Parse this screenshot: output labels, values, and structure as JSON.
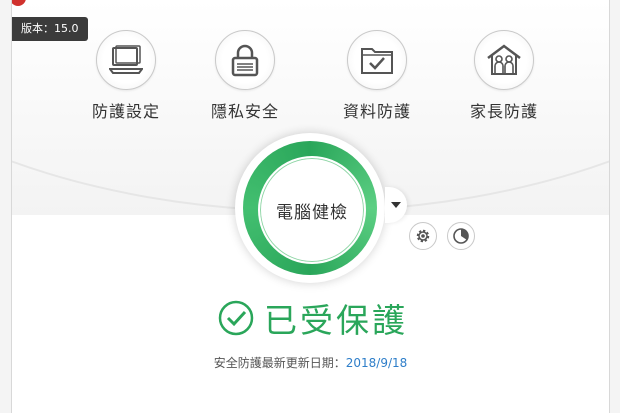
{
  "version_badge": "版本：15.0",
  "features": [
    {
      "label": "防護設定",
      "icon": "laptop-icon"
    },
    {
      "label": "隱私安全",
      "icon": "lock-icon"
    },
    {
      "label": "資料防護",
      "icon": "folder-check-icon"
    },
    {
      "label": "家長防護",
      "icon": "family-house-icon"
    }
  ],
  "scan": {
    "label": "電腦健檢"
  },
  "status": {
    "text": "已受保護",
    "color": "#2aa65a"
  },
  "update": {
    "label": "安全防護最新更新日期：",
    "date": "2018/9/18"
  },
  "colors": {
    "brand_red": "#d0312d",
    "accent_green": "#2aa65a",
    "link_blue": "#2e7ec9"
  }
}
